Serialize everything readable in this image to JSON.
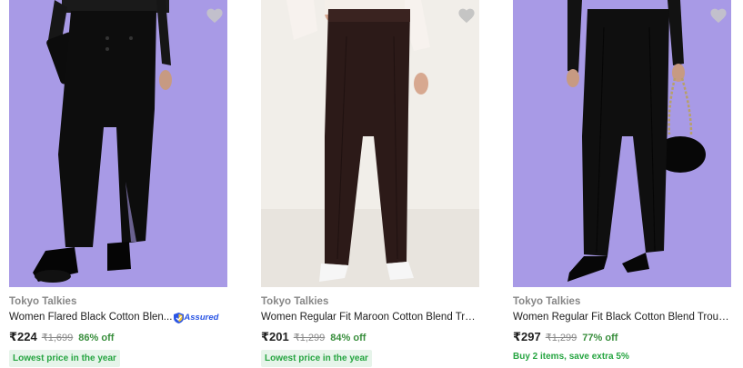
{
  "products": [
    {
      "brand": "Tokyo Talkies",
      "title": "Women Flared Black Cotton Blen...",
      "assured": "Assured",
      "price": "₹224",
      "mrp": "₹1,699",
      "discount": "86% off",
      "tag": "Lowest price in the year",
      "wishlist_icon": "heart-icon"
    },
    {
      "brand": "Tokyo Talkies",
      "title": "Women Regular Fit Maroon Cotton Blend Tro...",
      "price": "₹201",
      "mrp": "₹1,299",
      "discount": "84% off",
      "tag": "Lowest price in the year",
      "wishlist_icon": "heart-icon"
    },
    {
      "brand": "Tokyo Talkies",
      "title": "Women Regular Fit Black Cotton Blend Trous...",
      "price": "₹297",
      "mrp": "₹1,299",
      "discount": "77% off",
      "offer": "Buy 2 items, save extra 5%",
      "wishlist_icon": "heart-icon"
    }
  ],
  "colors": {
    "discount_green": "#388e3c",
    "tag_green": "#26a541",
    "tag_bg": "#e6f4ea",
    "assured_blue": "#2a55e5",
    "lavender_bg": "#a89ae6",
    "cream_bg": "#f1eee9"
  }
}
